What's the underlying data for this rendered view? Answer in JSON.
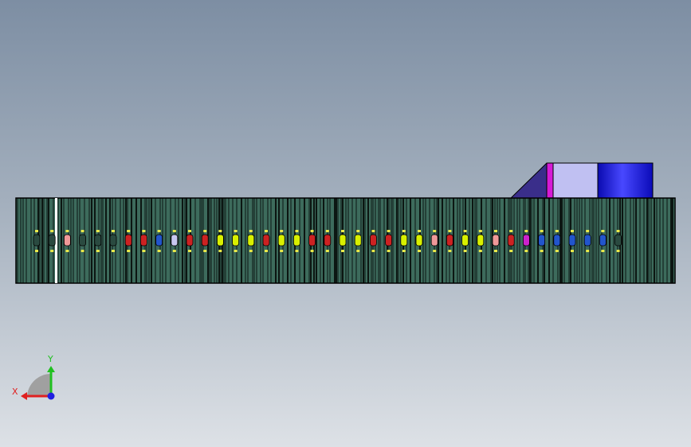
{
  "viewport": {
    "background_top": "#7d8ea3",
    "background_bottom": "#dde1e6"
  },
  "model": {
    "body_color": "#3d6b5c",
    "edge_color": "#000000",
    "slot_label_color": "#e8e84a",
    "accent_colors": {
      "red": "#cc2222",
      "pink": "#f09999",
      "lime": "#d8f000",
      "blue": "#2255cc",
      "magenta": "#cc22cc",
      "lavender": "#c8c8f0"
    },
    "top_block": {
      "ramp_color": "#3a2e8a",
      "magenta_strip": "#d61ad6",
      "light_face": "#c0c0f2",
      "cylinder_color": "#1a1ae0"
    }
  },
  "triad": {
    "x_label": "X",
    "y_label": "Y",
    "x_color": "#e02020",
    "y_color": "#20c020",
    "z_color": "#2020e0"
  }
}
